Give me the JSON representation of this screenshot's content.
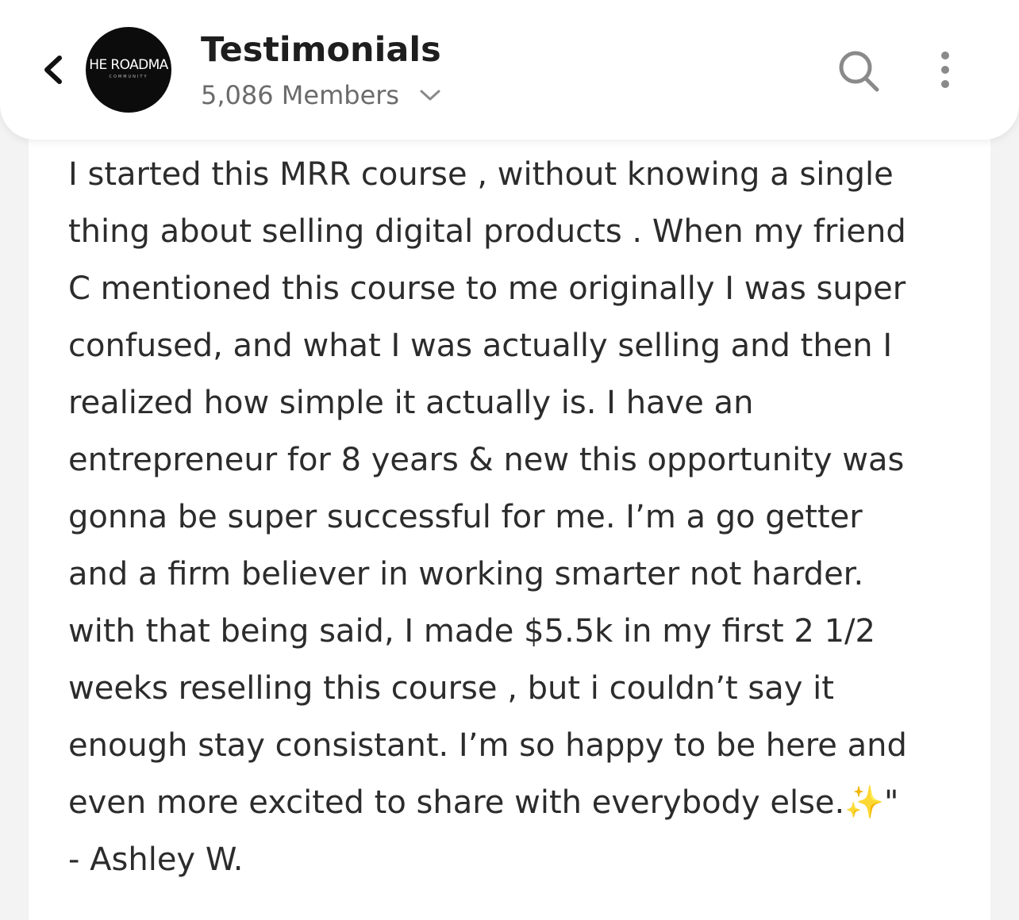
{
  "header": {
    "back_label": "Back",
    "avatar_text": "HE ROADMA",
    "avatar_sub": "COMMUNITY",
    "title": "Testimonials",
    "members": "5,086 Members"
  },
  "post": {
    "lines": [
      "I started this MRR course , without knowing a single",
      "thing about selling digital products . When my friend",
      "C mentioned this course to me originally I was super",
      "confused, and what I was actually selling and then I",
      "realized how simple it actually is. I have an",
      "entrepreneur for 8 years & new this opportunity was",
      "gonna be super successful for me. I’m a go getter",
      "and a firm believer in working smarter not harder.",
      "with that being said, I made $5.5k in my first 2 1/2",
      "weeks reselling this course , but i couldn’t say it",
      "enough stay consistant. I’m so happy to be here and",
      "even more excited to share with everybody else.✨\"",
      "- Ashley W."
    ]
  },
  "icons": {
    "back": "chevron-left-icon",
    "search": "search-icon",
    "more": "more-vertical-icon",
    "dropdown": "chevron-down-icon"
  },
  "colors": {
    "header_bg": "#ffffff",
    "page_bg": "#f3f3f4",
    "title": "#1e1e1e",
    "subtitle": "#6b6b6b",
    "icon": "#8a8a8a",
    "body_text": "#2c2c2c"
  }
}
